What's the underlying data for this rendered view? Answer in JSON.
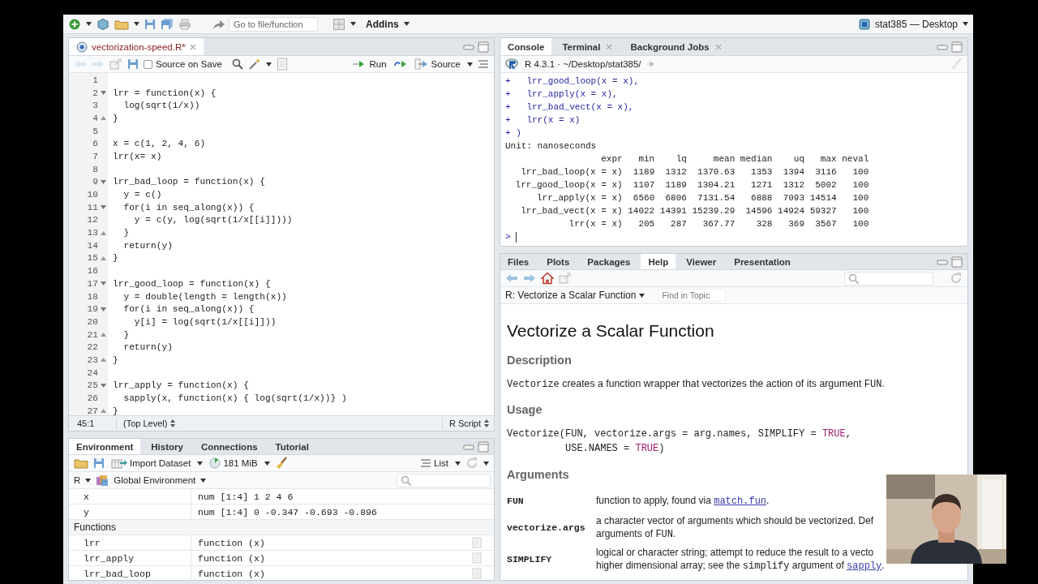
{
  "toolbar": {
    "goto_placeholder": "Go to file/function",
    "addins": "Addins",
    "project": "stat385 — Desktop"
  },
  "editor": {
    "tabs": [
      {
        "label": "vectorization-speed.R*",
        "selected": true
      }
    ],
    "source_on_save": {
      "label": "Source on Save",
      "checked": false
    },
    "run": "Run",
    "source": "Source",
    "lines": [
      {
        "num": "1"
      },
      {
        "num": "2",
        "fold_start": true,
        "text": "lrr = function(x) {"
      },
      {
        "num": "3",
        "text": "  log(sqrt(1/x))"
      },
      {
        "num": "4",
        "fold_end": true,
        "text": "}"
      },
      {
        "num": "5"
      },
      {
        "num": "6",
        "text": "x = c(1, 2, 4, 6)"
      },
      {
        "num": "7",
        "text": "lrr(x= x)"
      },
      {
        "num": "8"
      },
      {
        "num": "9",
        "fold_start": true,
        "text": "lrr_bad_loop = function(x) {"
      },
      {
        "num": "10",
        "text": "  y = c()"
      },
      {
        "num": "11",
        "fold_start": true,
        "text": "  for(i in seq_along(x)) {"
      },
      {
        "num": "12",
        "text": "    y = c(y, log(sqrt(1/x[[i]])))"
      },
      {
        "num": "13",
        "fold_end": true,
        "text": "  }"
      },
      {
        "num": "14",
        "text": "  return(y)"
      },
      {
        "num": "15",
        "fold_end": true,
        "text": "}"
      },
      {
        "num": "16"
      },
      {
        "num": "17",
        "fold_start": true,
        "text": "lrr_good_loop = function(x) {"
      },
      {
        "num": "18",
        "text": "  y = double(length = length(x))"
      },
      {
        "num": "19",
        "fold_start": true,
        "text": "  for(i in seq_along(x)) {"
      },
      {
        "num": "20",
        "text": "    y[i] = log(sqrt(1/x[[i]]))"
      },
      {
        "num": "21",
        "fold_end": true,
        "text": "  }"
      },
      {
        "num": "22",
        "text": "  return(y)"
      },
      {
        "num": "23",
        "fold_end": true,
        "text": "}"
      },
      {
        "num": "24"
      },
      {
        "num": "25",
        "fold_start": true,
        "text": "lrr_apply = function(x) {"
      },
      {
        "num": "26",
        "text": "  sapply(x, function(x) { log(sqrt(1/x))} )"
      },
      {
        "num": "27",
        "fold_end": true,
        "text": "}"
      }
    ],
    "status": {
      "position": "45:1",
      "scope": "(Top Level)",
      "type": "R Script"
    }
  },
  "console": {
    "tabs": [
      {
        "label": "Console",
        "selected": true,
        "closable": false
      },
      {
        "label": "Terminal",
        "selected": false,
        "closable": true
      },
      {
        "label": "Background Jobs",
        "selected": false,
        "closable": true
      }
    ],
    "path": "R 4.3.1 · ~/Desktop/stat385/",
    "lines": [
      {
        "kind": "input",
        "text": "+   lrr_good_loop(x = x),"
      },
      {
        "kind": "input",
        "text": "+   lrr_apply(x = x),"
      },
      {
        "kind": "input",
        "text": "+   lrr_bad_vect(x = x),"
      },
      {
        "kind": "input",
        "text": "+   lrr(x = x)"
      },
      {
        "kind": "input",
        "text": "+ )"
      },
      {
        "kind": "output",
        "text": "Unit: nanoseconds"
      }
    ],
    "benchmark": {
      "columns": [
        "expr",
        "min",
        "lq",
        "mean",
        "median",
        "uq",
        "max",
        "neval"
      ],
      "rows": [
        [
          "lrr_bad_loop(x = x)",
          "1189",
          "1312",
          "1370.63",
          "1353",
          "1394",
          "3116",
          "100"
        ],
        [
          "lrr_good_loop(x = x)",
          "1107",
          "1189",
          "1304.21",
          "1271",
          "1312",
          "5002",
          "100"
        ],
        [
          "lrr_apply(x = x)",
          "6560",
          "6806",
          "7131.54",
          "6888",
          "7093",
          "14514",
          "100"
        ],
        [
          "lrr_bad_vect(x = x)",
          "14022",
          "14391",
          "15239.29",
          "14596",
          "14924",
          "59327",
          "100"
        ],
        [
          "lrr(x = x)",
          "205",
          "287",
          "367.77",
          "328",
          "369",
          "3567",
          "100"
        ]
      ]
    },
    "prompt": ">"
  },
  "environment": {
    "tabs": [
      {
        "label": "Environment",
        "selected": true
      },
      {
        "label": "History",
        "selected": false
      },
      {
        "label": "Connections",
        "selected": false
      },
      {
        "label": "Tutorial",
        "selected": false
      }
    ],
    "import": "Import Dataset",
    "memory": "181 MiB",
    "view": "List",
    "language": "R",
    "scope": "Global Environment",
    "rows": [
      {
        "kind": "value",
        "name": "x",
        "value": "num [1:4] 1 2 4 6"
      },
      {
        "kind": "value",
        "name": "y",
        "value": "num [1:4] 0 -0.347 -0.693 -0.896"
      },
      {
        "kind": "section",
        "name": "Functions"
      },
      {
        "kind": "function",
        "name": "lrr",
        "value": "function (x)"
      },
      {
        "kind": "function",
        "name": "lrr_apply",
        "value": "function (x)"
      },
      {
        "kind": "function",
        "name": "lrr_bad_loop",
        "value": "function (x)"
      }
    ]
  },
  "help": {
    "tabs": [
      {
        "label": "Files",
        "selected": false
      },
      {
        "label": "Plots",
        "selected": false
      },
      {
        "label": "Packages",
        "selected": false
      },
      {
        "label": "Help",
        "selected": true
      },
      {
        "label": "Viewer",
        "selected": false
      },
      {
        "label": "Presentation",
        "selected": false
      }
    ],
    "topic": "R: Vectorize a Scalar Function",
    "find_placeholder": "Find in Topic",
    "title": "Vectorize a Scalar Function",
    "sections": [
      {
        "kind": "text",
        "heading": "Description",
        "lines": [
          [
            {
              "kind": "code",
              "text": "Vectorize"
            },
            {
              "kind": "plain",
              "text": " creates a function wrapper that vectorizes the action of its argument "
            },
            {
              "kind": "code",
              "text": "FUN"
            },
            {
              "kind": "plain",
              "text": "."
            }
          ]
        ]
      },
      {
        "kind": "code",
        "heading": "Usage",
        "lines": [
          [
            {
              "kind": "code",
              "text": "Vectorize(FUN, vectorize.args = arg.names, SIMPLIFY = "
            },
            {
              "kind": "value",
              "text": "TRUE"
            },
            {
              "kind": "code",
              "text": ","
            }
          ],
          [
            {
              "kind": "code",
              "text": "          USE.NAMES = "
            },
            {
              "kind": "value",
              "text": "TRUE"
            },
            {
              "kind": "code",
              "text": ")"
            }
          ]
        ]
      },
      {
        "kind": "arguments",
        "heading": "Arguments",
        "args": [
          {
            "name": "FUN",
            "lines": [
              [
                {
                  "kind": "plain",
                  "text": "function to apply, found via "
                },
                {
                  "kind": "link",
                  "text": "match.fun"
                },
                {
                  "kind": "plain",
                  "text": "."
                }
              ]
            ]
          },
          {
            "name": "vectorize.args",
            "lines": [
              [
                {
                  "kind": "plain",
                  "text": "a character vector of arguments which should be vectorized. Def"
                }
              ],
              [
                {
                  "kind": "plain",
                  "text": "arguments of "
                },
                {
                  "kind": "code",
                  "text": "FUN"
                },
                {
                  "kind": "plain",
                  "text": "."
                }
              ]
            ]
          },
          {
            "name": "SIMPLIFY",
            "lines": [
              [
                {
                  "kind": "plain",
                  "text": "logical or character string; attempt to reduce the result to a vecto"
                }
              ],
              [
                {
                  "kind": "plain",
                  "text": "higher dimensional array; see the "
                },
                {
                  "kind": "code",
                  "text": "simplify"
                },
                {
                  "kind": "plain",
                  "text": " argument of "
                },
                {
                  "kind": "link",
                  "text": "sapply"
                },
                {
                  "kind": "plain",
                  "text": "."
                }
              ]
            ]
          }
        ]
      }
    ]
  }
}
